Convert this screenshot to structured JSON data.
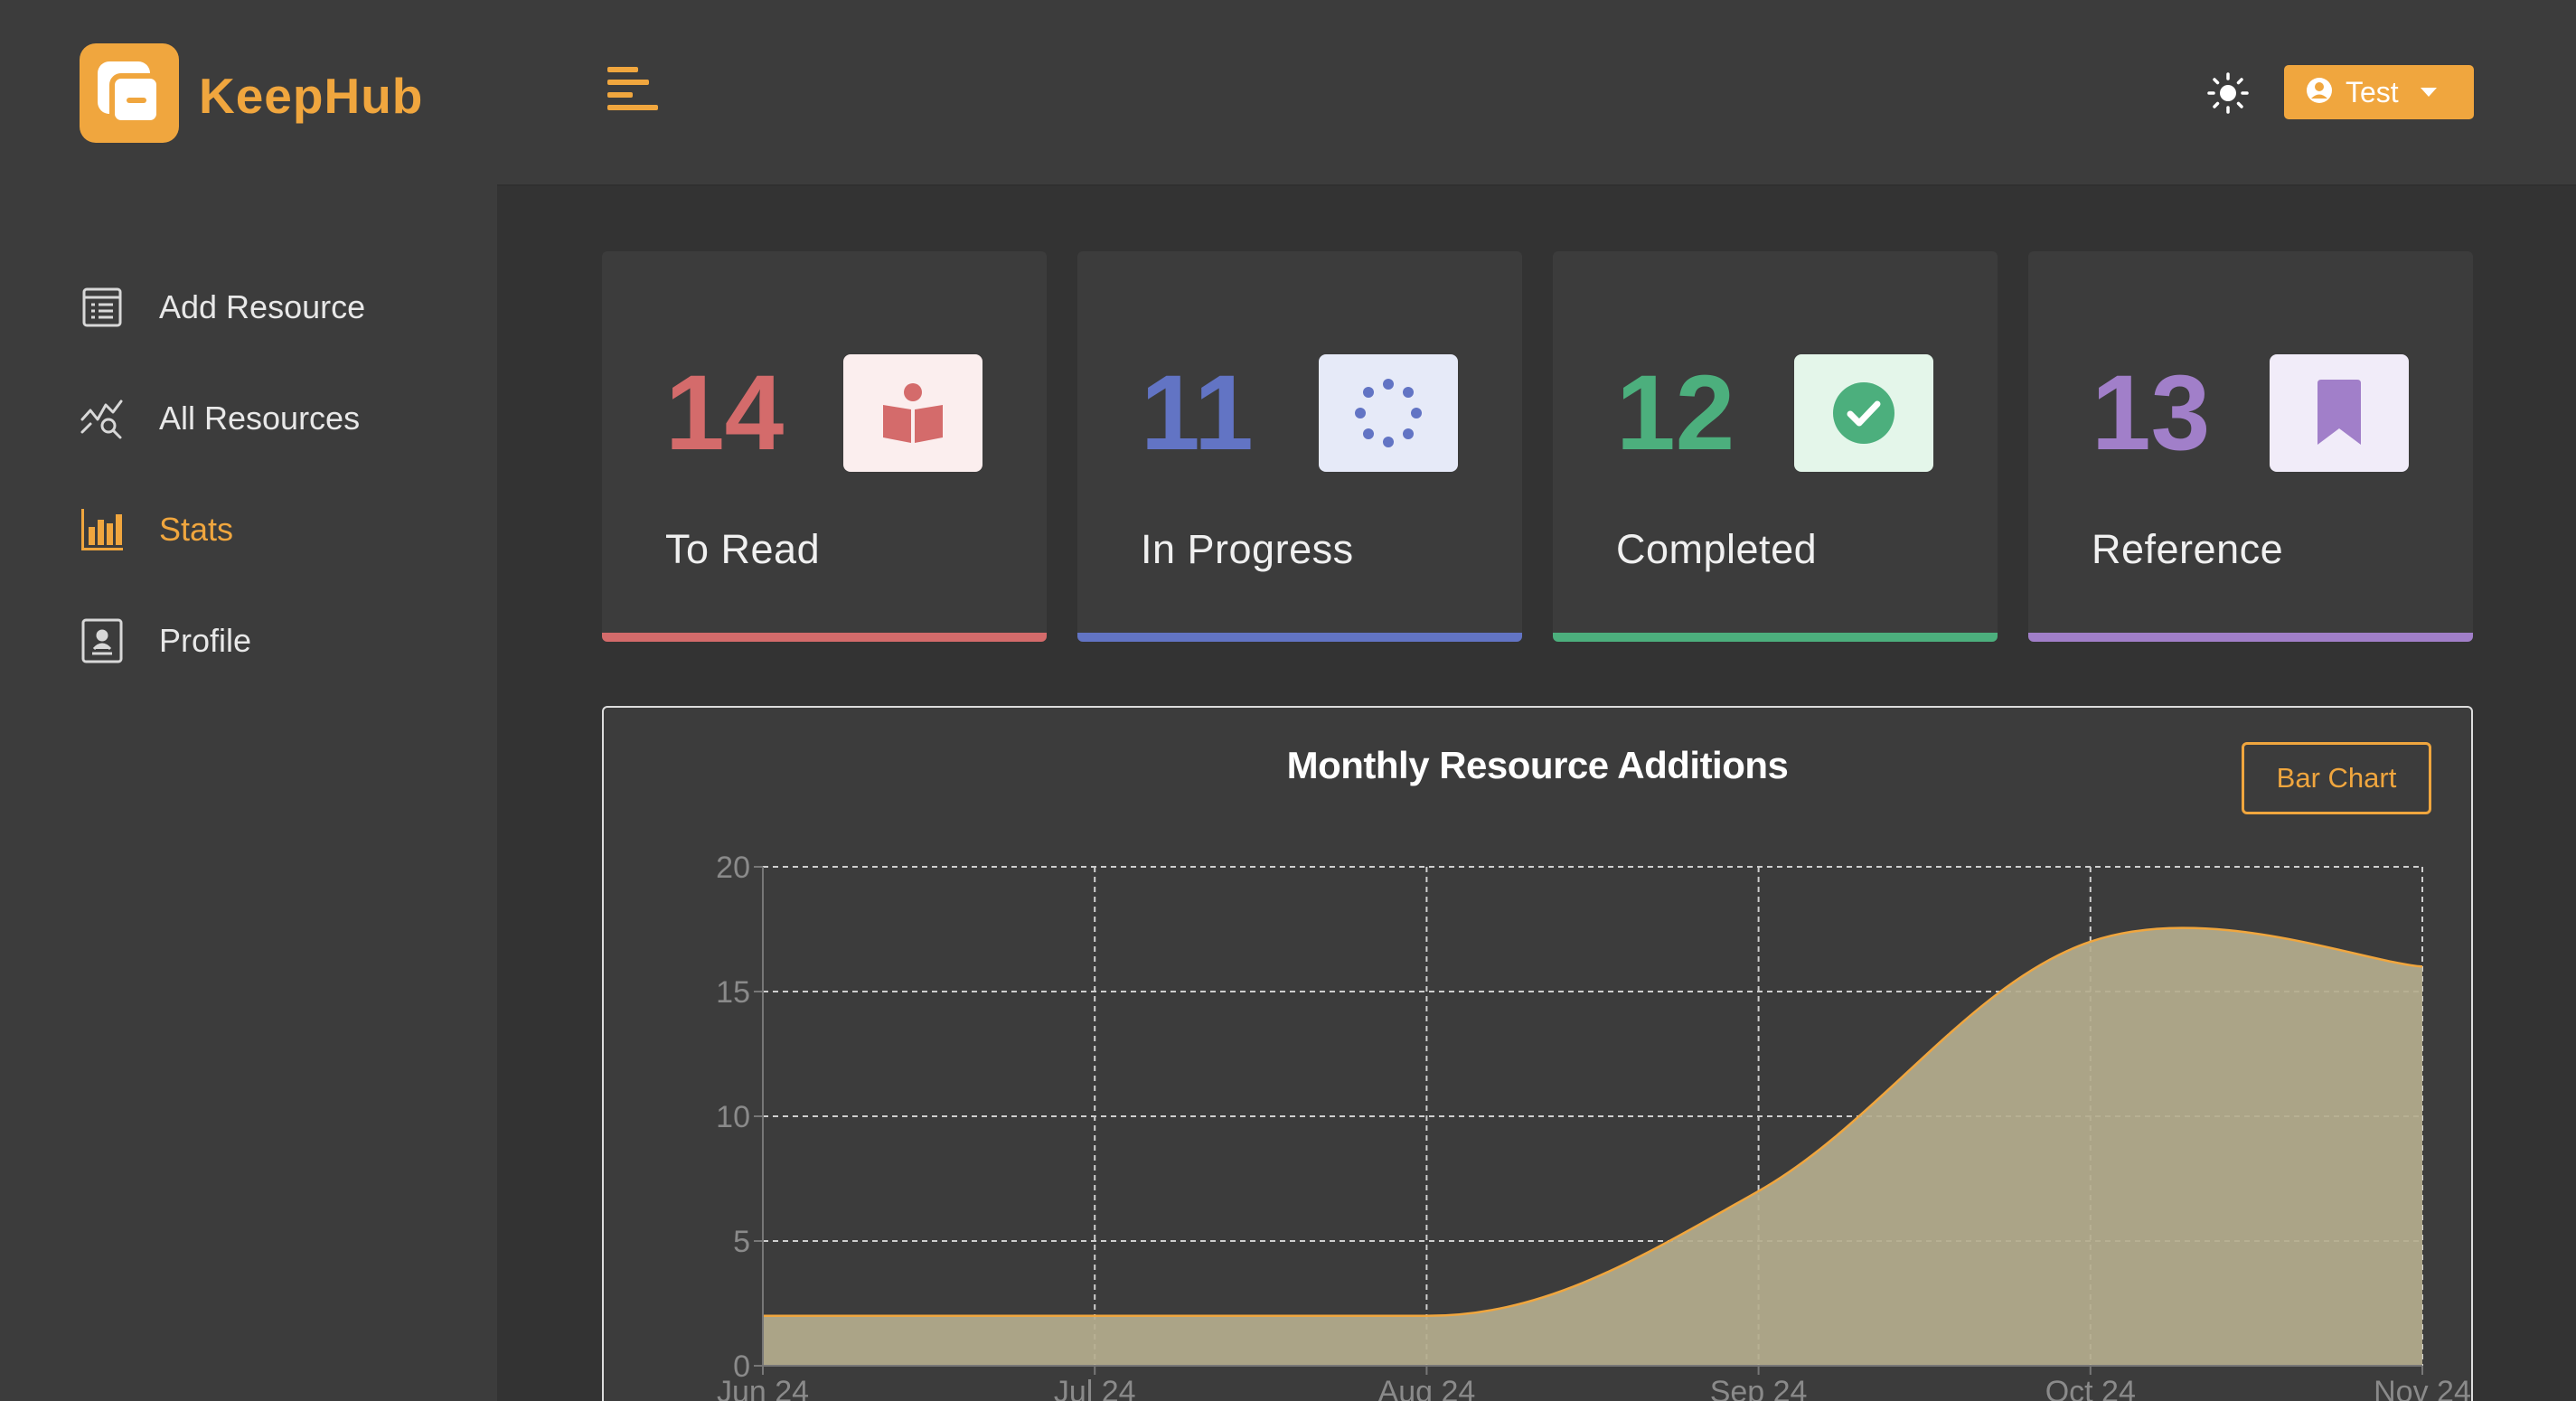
{
  "brand": {
    "name": "KeepHub",
    "accent": "#f0a63e"
  },
  "sidebar": {
    "items": [
      {
        "label": "Add Resource",
        "icon": "add-resource-icon"
      },
      {
        "label": "All Resources",
        "icon": "analytics-search-icon"
      },
      {
        "label": "Stats",
        "icon": "bar-chart-icon",
        "active": true
      },
      {
        "label": "Profile",
        "icon": "profile-icon"
      }
    ]
  },
  "header": {
    "menu_icon": "hamburger-icon",
    "theme_icon": "sun-icon",
    "user": {
      "name": "Test",
      "icon": "user-circle-icon"
    }
  },
  "stats": [
    {
      "value": "14",
      "label": "To Read",
      "color": "#d46b6b",
      "icon": "reading-icon"
    },
    {
      "value": "11",
      "label": "In Progress",
      "color": "#6274c4",
      "icon": "loading-spinner-icon"
    },
    {
      "value": "12",
      "label": "Completed",
      "color": "#4caf7d",
      "icon": "check-circle-icon"
    },
    {
      "value": "13",
      "label": "Reference",
      "color": "#a17fc9",
      "icon": "bookmark-icon"
    }
  ],
  "chart": {
    "toggle_label": "Bar Chart"
  },
  "chart_data": {
    "type": "area",
    "title": "Monthly Resource Additions",
    "x": [
      "Jun 24",
      "Jul 24",
      "Aug 24",
      "Sep 24",
      "Oct 24",
      "Nov 24"
    ],
    "series": [
      {
        "values": [
          2,
          2,
          2,
          7,
          17,
          16
        ]
      }
    ],
    "ylim": [
      0,
      20
    ],
    "yticks": [
      0,
      5,
      10,
      15,
      20
    ],
    "grid": true,
    "fill_color": "#b5ae8e",
    "line_color": "#f0a63e"
  }
}
